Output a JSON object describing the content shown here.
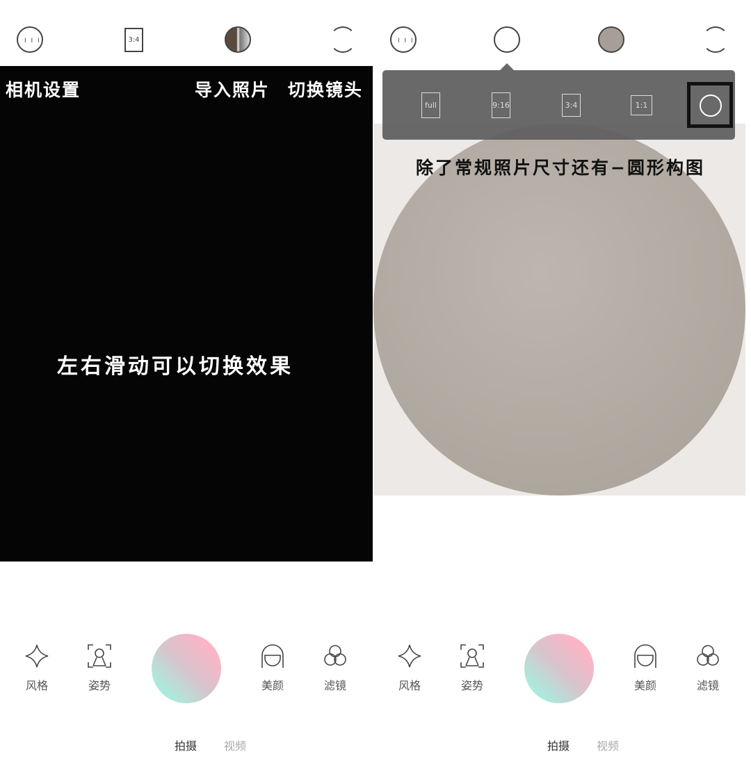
{
  "left": {
    "top_icons": [
      "settings-icon",
      "ratio-icon",
      "gallery-thumbnail",
      "switch-camera-icon"
    ],
    "ratio_label": "3:4",
    "annotations": {
      "camera_settings": "相机设置",
      "import_photo": "导入照片",
      "switch_lens": "切换镜头",
      "swipe_hint": "左右滑动可以切换效果"
    },
    "tools": [
      {
        "label": "风格",
        "icon": "sparkle-icon"
      },
      {
        "label": "姿势",
        "icon": "pose-icon"
      },
      {
        "label": "美颜",
        "icon": "beauty-icon"
      },
      {
        "label": "滤镜",
        "icon": "filter-icon"
      }
    ],
    "modes": {
      "photo": "拍摄",
      "video": "视频"
    }
  },
  "right": {
    "ratio_options": [
      "full",
      "9:16",
      "3:4",
      "1:1"
    ],
    "selected_ratio": "circle",
    "annotation": "除了常规照片尺寸还有−圆形构图",
    "tools": [
      {
        "label": "风格",
        "icon": "sparkle-icon"
      },
      {
        "label": "姿势",
        "icon": "pose-icon"
      },
      {
        "label": "美颜",
        "icon": "beauty-icon"
      },
      {
        "label": "滤镜",
        "icon": "filter-icon"
      }
    ],
    "modes": {
      "photo": "拍摄",
      "video": "视频"
    }
  },
  "colors": {
    "popup": "#6b6a6a",
    "photo": "#b5aea6",
    "mode_active": "#333333",
    "mode_inactive": "#aaaaaa"
  }
}
